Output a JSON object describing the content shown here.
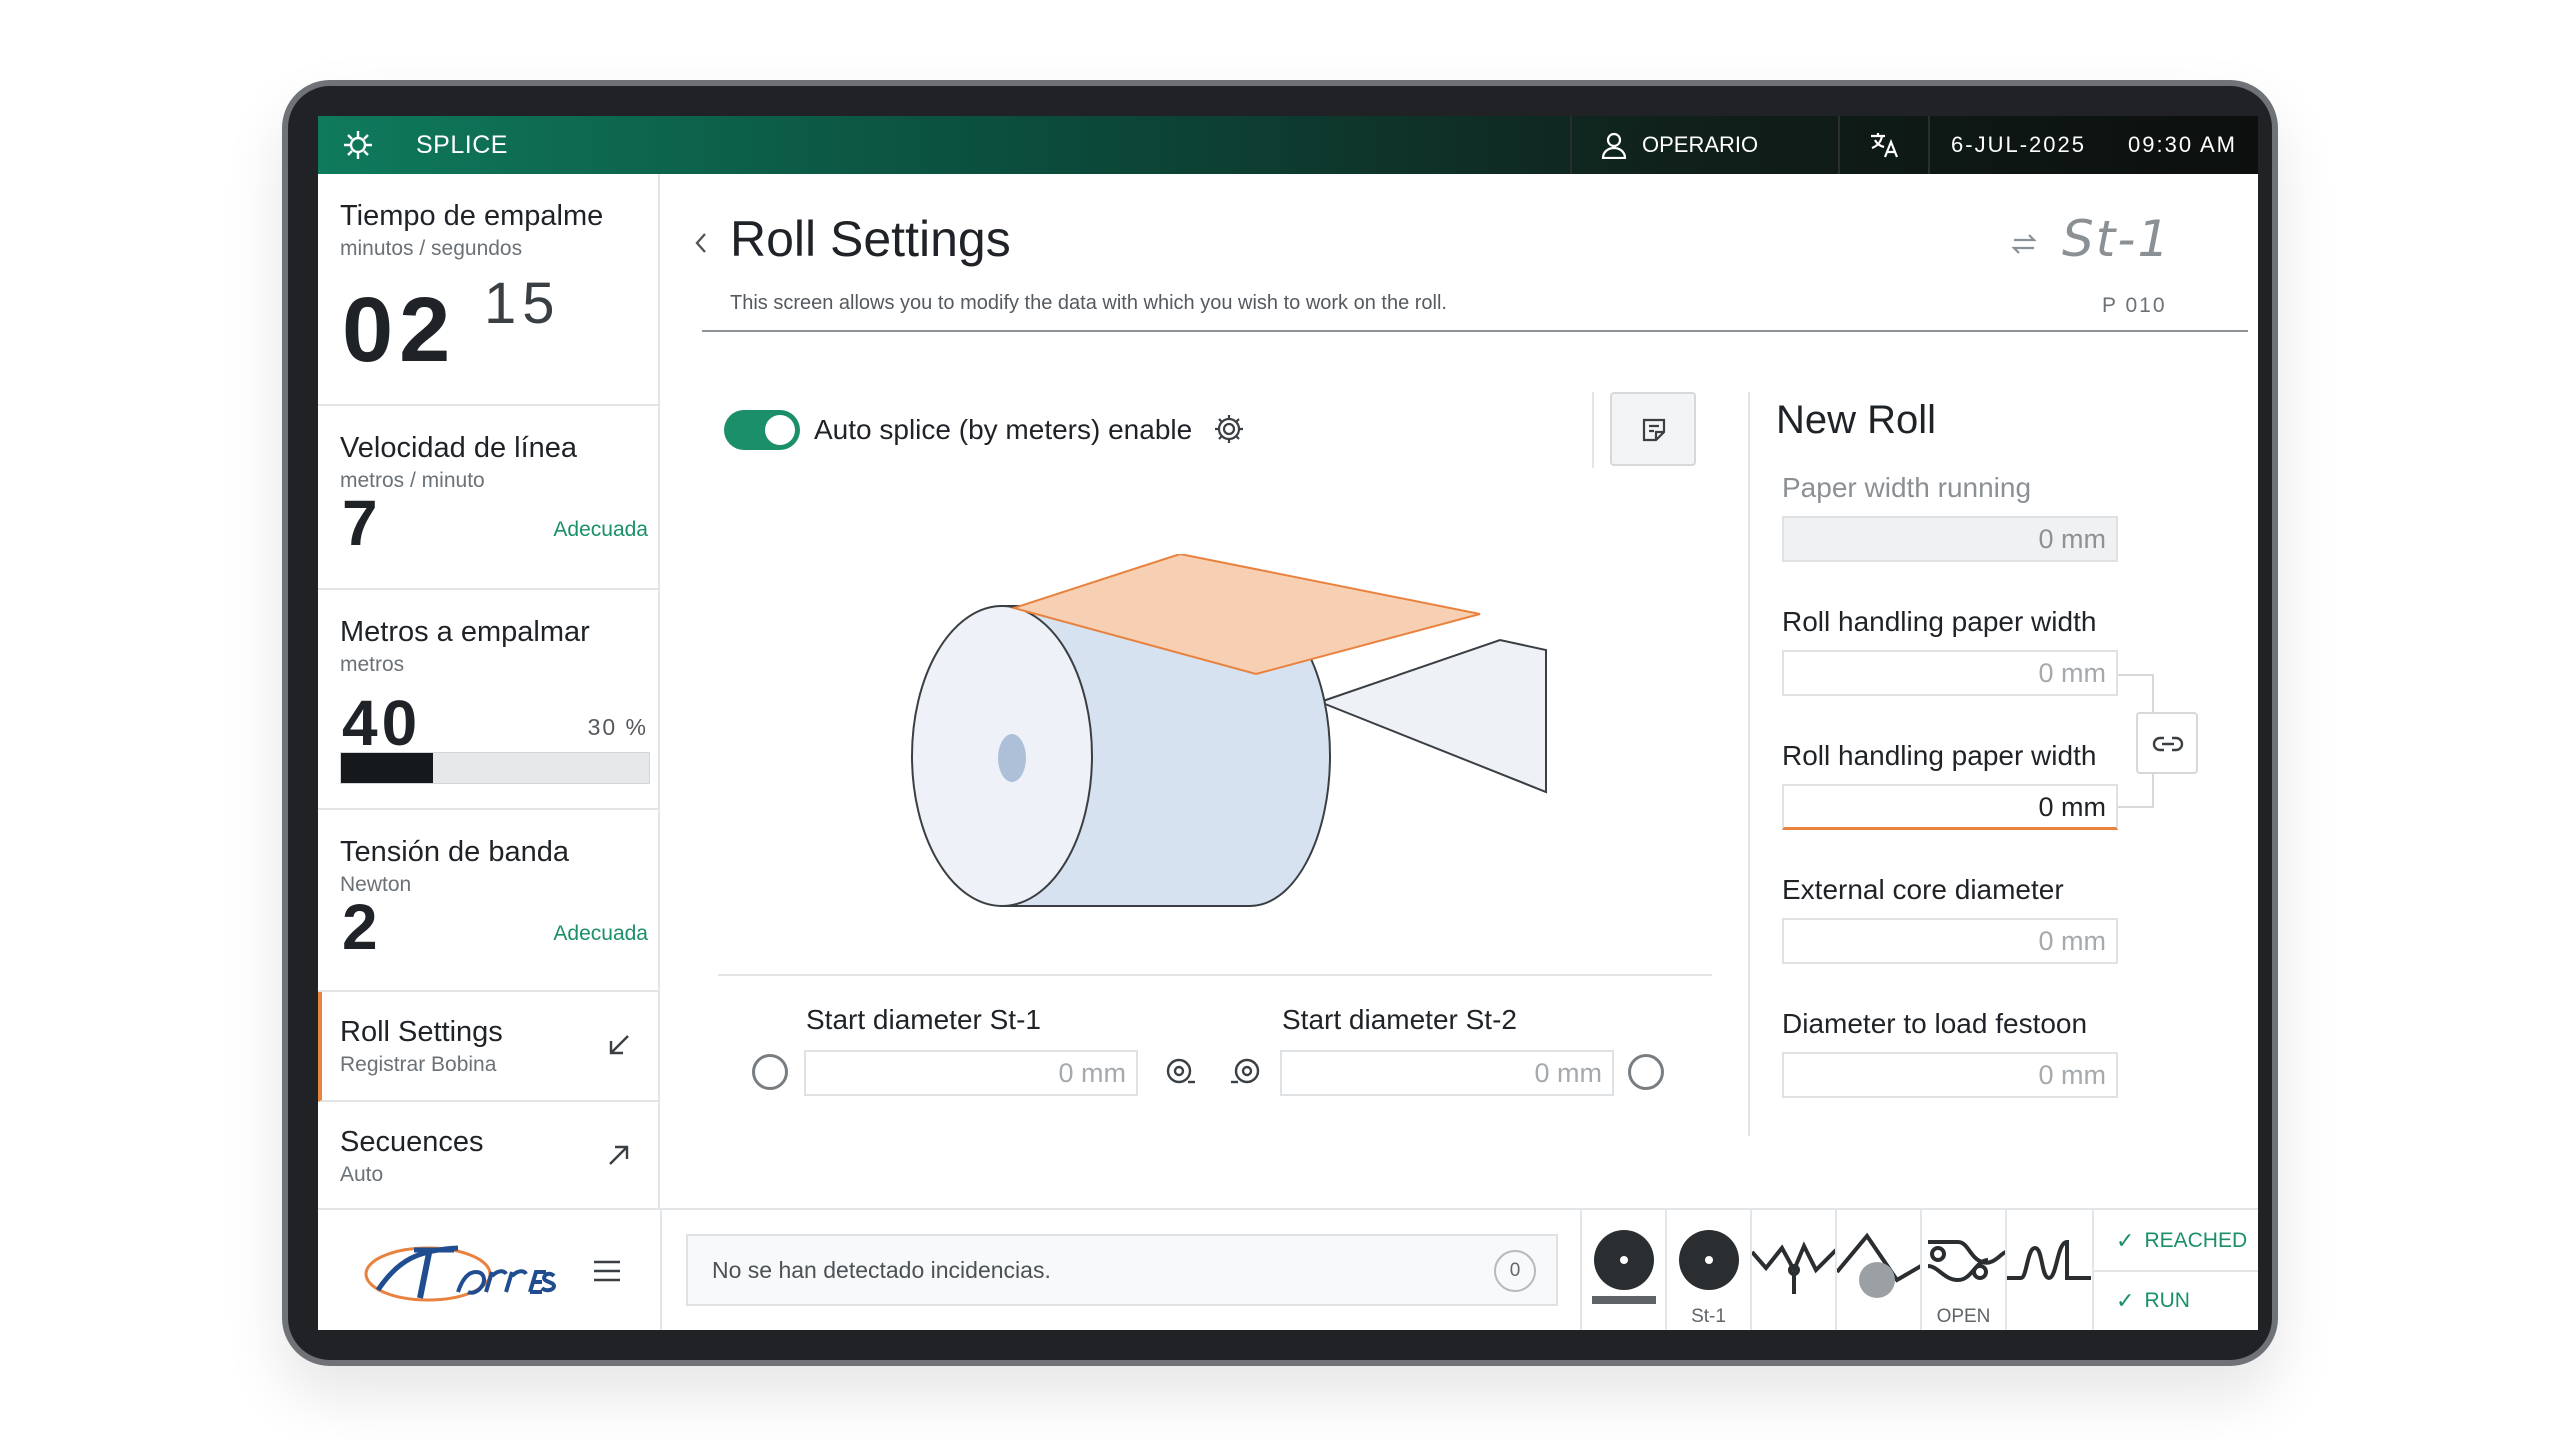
{
  "topbar": {
    "app_title": "SPLICE",
    "user": "OPERARIO",
    "date": "6-JUL-2025",
    "time": "09:30 AM"
  },
  "sidebar": {
    "splice_time": {
      "title": "Tiempo de empalme",
      "unit": "minutos / segundos",
      "minutes": "02",
      "seconds": "15"
    },
    "line_speed": {
      "title": "Velocidad de línea",
      "unit": "metros / minuto",
      "value": "7",
      "status": "Adecuada"
    },
    "meters": {
      "title": "Metros a empalmar",
      "unit": "metros",
      "value": "40",
      "percent_label": "30 %",
      "progress": 0.3
    },
    "tension": {
      "title": "Tensión de banda",
      "unit": "Newton",
      "value": "2",
      "status": "Adecuada"
    },
    "nav": [
      {
        "title": "Roll Settings",
        "subtitle": "Registrar Bobina"
      },
      {
        "title": "Secuences",
        "subtitle": "Auto"
      }
    ]
  },
  "main": {
    "title": "Roll Settings",
    "description": "This screen allows you to modify the data with which you wish to work on the roll.",
    "station": "St-1",
    "page_code": "P 010",
    "auto_splice_label": "Auto splice (by meters) enable",
    "auto_splice_enabled": true,
    "start_diameter_st1": {
      "label": "Start diameter St-1",
      "value": "0 mm"
    },
    "start_diameter_st2": {
      "label": "Start diameter St-2",
      "value": "0 mm"
    }
  },
  "new_roll": {
    "title": "New Roll",
    "fields": [
      {
        "label": "Paper width running",
        "value": "0 mm"
      },
      {
        "label": "Roll handling paper width",
        "value": "0 mm"
      },
      {
        "label": "Roll handling paper width",
        "value": "0 mm"
      },
      {
        "label": "External core diameter",
        "value": "0 mm"
      },
      {
        "label": "Diameter to load festoon",
        "value": "0 mm"
      }
    ]
  },
  "bottombar": {
    "incidents_text": "No se han detectado incidencias.",
    "incidents_count": "0",
    "machine_labels": {
      "station": "St-1",
      "open": "OPEN"
    },
    "status": {
      "reached": "REACHED",
      "run": "RUN"
    }
  },
  "colors": {
    "accent_green": "#1a8f6a",
    "accent_orange": "#e8823e",
    "dark": "#16191c"
  }
}
